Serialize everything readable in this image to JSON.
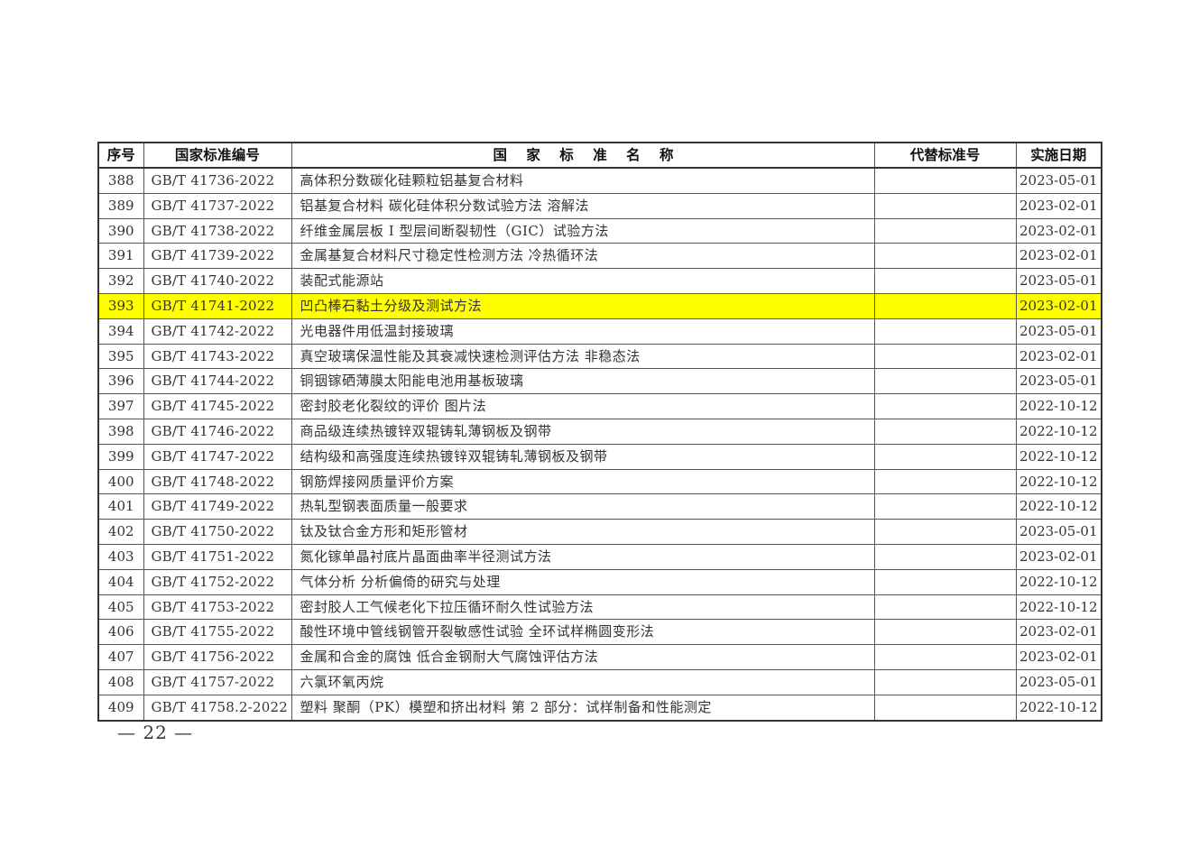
{
  "table": {
    "headers": {
      "seq": "序号",
      "code": "国家标准编号",
      "name": "国 家 标 准 名 称",
      "replaced": "代替标准号",
      "date": "实施日期"
    },
    "rows": [
      {
        "seq": "388",
        "code": "GB/T 41736-2022",
        "name": "高体积分数碳化硅颗粒铝基复合材料",
        "replaced": "",
        "date": "2023-05-01"
      },
      {
        "seq": "389",
        "code": "GB/T 41737-2022",
        "name": "铝基复合材料 碳化硅体积分数试验方法 溶解法",
        "replaced": "",
        "date": "2023-02-01"
      },
      {
        "seq": "390",
        "code": "GB/T 41738-2022",
        "name": "纤维金属层板 I 型层间断裂韧性（GIC）试验方法",
        "replaced": "",
        "date": "2023-02-01"
      },
      {
        "seq": "391",
        "code": "GB/T 41739-2022",
        "name": "金属基复合材料尺寸稳定性检测方法 冷热循环法",
        "replaced": "",
        "date": "2023-02-01"
      },
      {
        "seq": "392",
        "code": "GB/T 41740-2022",
        "name": "装配式能源站",
        "replaced": "",
        "date": "2023-05-01"
      },
      {
        "seq": "393",
        "code": "GB/T 41741-2022",
        "name": "凹凸棒石黏土分级及测试方法",
        "replaced": "",
        "date": "2023-02-01",
        "highlight": true
      },
      {
        "seq": "394",
        "code": "GB/T 41742-2022",
        "name": "光电器件用低温封接玻璃",
        "replaced": "",
        "date": "2023-05-01"
      },
      {
        "seq": "395",
        "code": "GB/T 41743-2022",
        "name": "真空玻璃保温性能及其衰减快速检测评估方法 非稳态法",
        "replaced": "",
        "date": "2023-02-01"
      },
      {
        "seq": "396",
        "code": "GB/T 41744-2022",
        "name": "铜铟镓硒薄膜太阳能电池用基板玻璃",
        "replaced": "",
        "date": "2023-05-01"
      },
      {
        "seq": "397",
        "code": "GB/T 41745-2022",
        "name": "密封胶老化裂纹的评价 图片法",
        "replaced": "",
        "date": "2022-10-12"
      },
      {
        "seq": "398",
        "code": "GB/T 41746-2022",
        "name": "商品级连续热镀锌双辊铸轧薄钢板及钢带",
        "replaced": "",
        "date": "2022-10-12"
      },
      {
        "seq": "399",
        "code": "GB/T 41747-2022",
        "name": "结构级和高强度连续热镀锌双辊铸轧薄钢板及钢带",
        "replaced": "",
        "date": "2022-10-12"
      },
      {
        "seq": "400",
        "code": "GB/T 41748-2022",
        "name": "钢筋焊接网质量评价方案",
        "replaced": "",
        "date": "2022-10-12"
      },
      {
        "seq": "401",
        "code": "GB/T 41749-2022",
        "name": "热轧型钢表面质量一般要求",
        "replaced": "",
        "date": "2022-10-12"
      },
      {
        "seq": "402",
        "code": "GB/T 41750-2022",
        "name": "钛及钛合金方形和矩形管材",
        "replaced": "",
        "date": "2023-05-01"
      },
      {
        "seq": "403",
        "code": "GB/T 41751-2022",
        "name": "氮化镓单晶衬底片晶面曲率半径测试方法",
        "replaced": "",
        "date": "2023-02-01"
      },
      {
        "seq": "404",
        "code": "GB/T 41752-2022",
        "name": "气体分析 分析偏倚的研究与处理",
        "replaced": "",
        "date": "2022-10-12"
      },
      {
        "seq": "405",
        "code": "GB/T 41753-2022",
        "name": "密封胶人工气候老化下拉压循环耐久性试验方法",
        "replaced": "",
        "date": "2022-10-12"
      },
      {
        "seq": "406",
        "code": "GB/T 41755-2022",
        "name": "酸性环境中管线钢管开裂敏感性试验 全环试样椭圆变形法",
        "replaced": "",
        "date": "2023-02-01"
      },
      {
        "seq": "407",
        "code": "GB/T 41756-2022",
        "name": "金属和合金的腐蚀 低合金钢耐大气腐蚀评估方法",
        "replaced": "",
        "date": "2023-02-01"
      },
      {
        "seq": "408",
        "code": "GB/T 41757-2022",
        "name": "六氯环氧丙烷",
        "replaced": "",
        "date": "2023-05-01"
      },
      {
        "seq": "409",
        "code": "GB/T 41758.2-2022",
        "name": "塑料 聚酮（PK）模塑和挤出材料 第 2 部分：试样制备和性能测定",
        "replaced": "",
        "date": "2022-10-12"
      }
    ]
  },
  "footer": {
    "page_number": "— 22 —"
  },
  "colors": {
    "highlight": "#ffff00",
    "border": "#333333"
  }
}
